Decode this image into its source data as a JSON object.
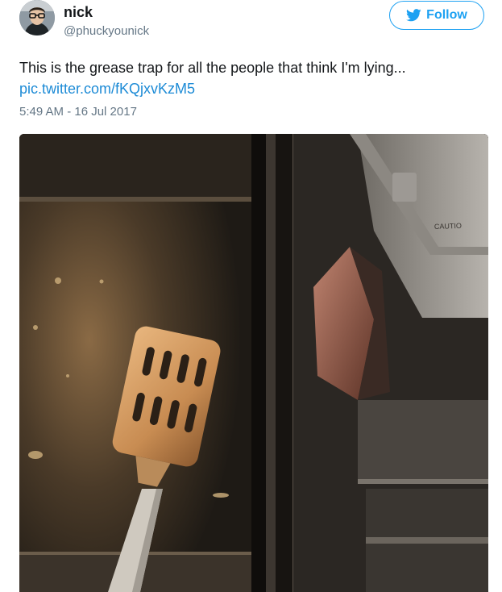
{
  "user": {
    "name": "nick",
    "handle": "@phuckyounick",
    "avatar_icon": "user-avatar"
  },
  "follow": {
    "label": "Follow",
    "icon": "twitter-bird-icon",
    "color": "#1da1f2"
  },
  "tweet": {
    "text": "This is the grease trap for all the people that think I'm lying...",
    "link": "pic.twitter.com/fKQjxvKzM5",
    "link_color": "#1d8bd6",
    "timestamp": "5:49 AM - 16 Jul 2017"
  },
  "photo": {
    "subject": "grease trap with spatula",
    "caution_text": "CAUTIO"
  }
}
